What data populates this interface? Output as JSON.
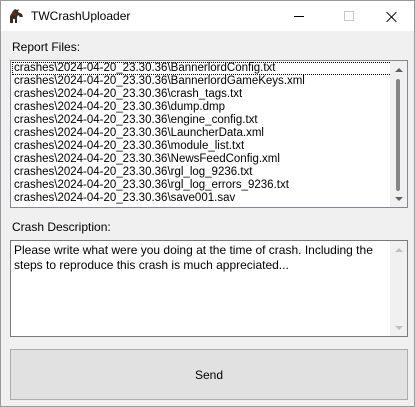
{
  "window": {
    "title": "TWCrashUploader",
    "icon": "bannerlord-horse-icon"
  },
  "report_files": {
    "label": "Report Files:",
    "items": [
      "crashes\\2024-04-20_23.30.36\\BannerlordConfig.txt",
      "crashes\\2024-04-20_23.30.36\\BannerlordGameKeys.xml",
      "crashes\\2024-04-20_23.30.36\\crash_tags.txt",
      "crashes\\2024-04-20_23.30.36\\dump.dmp",
      "crashes\\2024-04-20_23.30.36\\engine_config.txt",
      "crashes\\2024-04-20_23.30.36\\LauncherData.xml",
      "crashes\\2024-04-20_23.30.36\\module_list.txt",
      "crashes\\2024-04-20_23.30.36\\NewsFeedConfig.xml",
      "crashes\\2024-04-20_23.30.36\\rgl_log_9236.txt",
      "crashes\\2024-04-20_23.30.36\\rgl_log_errors_9236.txt",
      "crashes\\2024-04-20_23.30.36\\save001.sav"
    ]
  },
  "crash_description": {
    "label": "Crash Description:",
    "value": "Please write what were you doing at the time of crash. Including the steps to reproduce this crash is much appreciated..."
  },
  "send_button": {
    "label": "Send"
  }
}
